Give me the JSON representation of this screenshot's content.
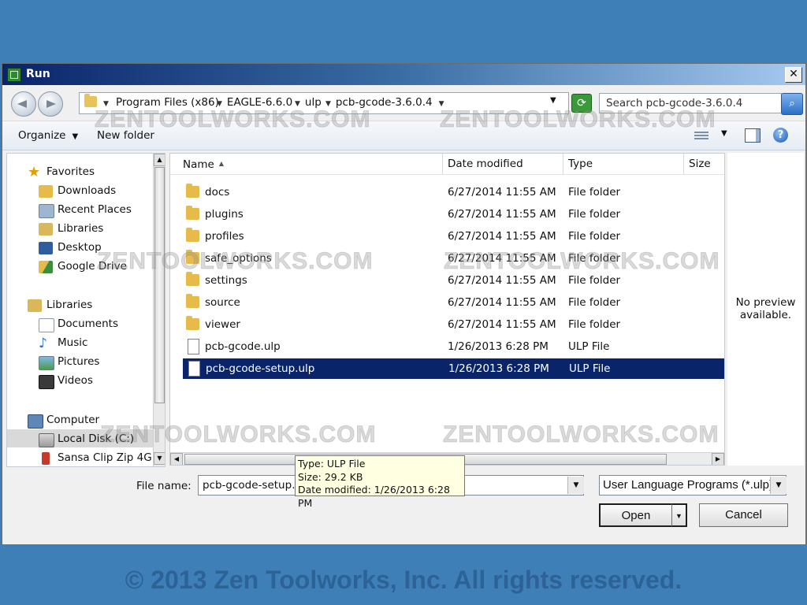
{
  "dialog": {
    "title": "Run",
    "close_label": "✕"
  },
  "address": {
    "crumbs": [
      "Program Files (x86)",
      "EAGLE-6.6.0",
      "ulp",
      "pcb-gcode-3.6.0.4"
    ],
    "search_placeholder": "Search pcb-gcode-3.6.0.4"
  },
  "toolbar": {
    "organize": "Organize",
    "new_folder": "New folder"
  },
  "navpane": {
    "favorites": "Favorites",
    "downloads": "Downloads",
    "recent_places": "Recent Places",
    "libraries_fav": "Libraries",
    "desktop": "Desktop",
    "google_drive": "Google Drive",
    "libraries": "Libraries",
    "documents": "Documents",
    "music": "Music",
    "pictures": "Pictures",
    "videos": "Videos",
    "computer": "Computer",
    "local_disk": "Local Disk (C:)",
    "sansa": "Sansa Clip Zip 4GB"
  },
  "columns": {
    "name": "Name",
    "date": "Date modified",
    "type": "Type",
    "size": "Size"
  },
  "files": [
    {
      "name": "docs",
      "date": "6/27/2014 11:55 AM",
      "type": "File folder"
    },
    {
      "name": "plugins",
      "date": "6/27/2014 11:55 AM",
      "type": "File folder"
    },
    {
      "name": "profiles",
      "date": "6/27/2014 11:55 AM",
      "type": "File folder"
    },
    {
      "name": "safe_options",
      "date": "6/27/2014 11:55 AM",
      "type": "File folder"
    },
    {
      "name": "settings",
      "date": "6/27/2014 11:55 AM",
      "type": "File folder"
    },
    {
      "name": "source",
      "date": "6/27/2014 11:55 AM",
      "type": "File folder"
    },
    {
      "name": "viewer",
      "date": "6/27/2014 11:55 AM",
      "type": "File folder"
    },
    {
      "name": "pcb-gcode.ulp",
      "date": "1/26/2013 6:28 PM",
      "type": "ULP File"
    },
    {
      "name": "pcb-gcode-setup.ulp",
      "date": "1/26/2013 6:28 PM",
      "type": "ULP File"
    }
  ],
  "tooltip": {
    "type": "Type: ULP File",
    "size": "Size: 29.2 KB",
    "date": "Date modified: 1/26/2013 6:28 PM"
  },
  "preview": {
    "line1": "No preview",
    "line2": "available."
  },
  "bottom": {
    "file_name_label": "File name:",
    "file_name_value": "pcb-gcode-setup.ulp",
    "filter_value": "User Language Programs (*.ulp)",
    "open_label": "Open",
    "cancel_label": "Cancel"
  },
  "watermark": "ZENTOOLWORKS.COM",
  "copyright": "© 2013 Zen Toolworks, Inc. All rights reserved.",
  "colors": {
    "background": "#3f7fb7",
    "selection": "#0a246a",
    "tooltip": "#ffffe1"
  }
}
